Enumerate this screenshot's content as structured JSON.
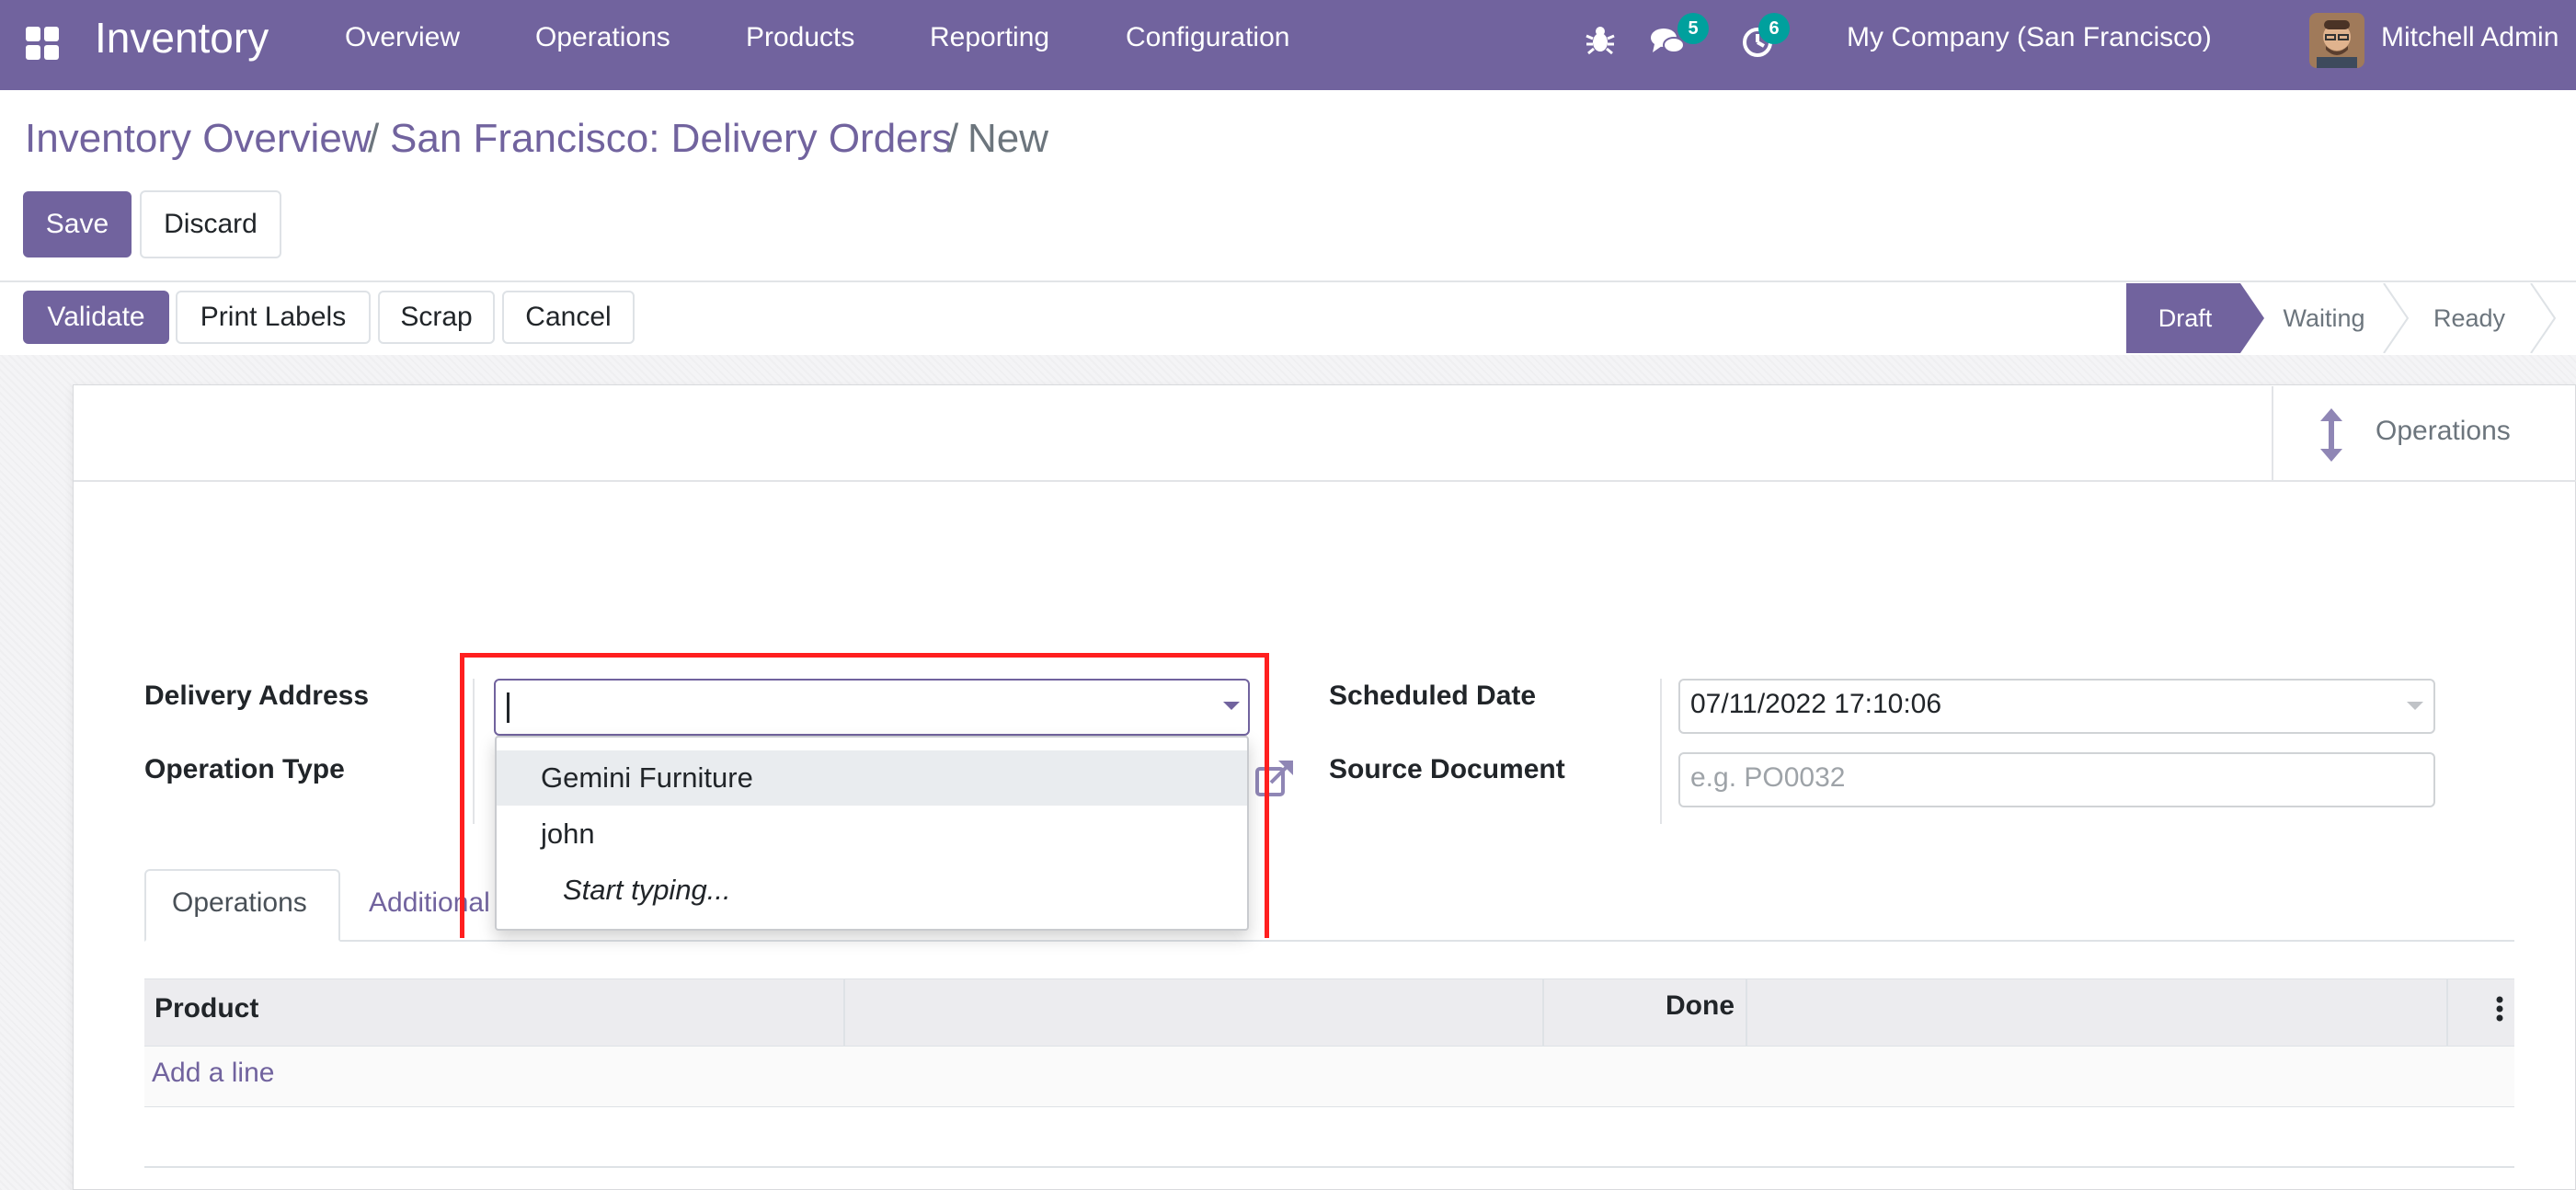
{
  "app": {
    "brand": "Inventory",
    "menus": [
      "Overview",
      "Operations",
      "Products",
      "Reporting",
      "Configuration"
    ],
    "messages_count": "5",
    "activities_count": "6",
    "company": "My Company (San Francisco)",
    "user": "Mitchell Admin",
    "navbar_color": "#71639e"
  },
  "breadcrumb": {
    "items": [
      "Inventory Overview",
      "San Francisco: Delivery Orders"
    ],
    "separator": "/",
    "current": "New"
  },
  "actions": {
    "save": "Save",
    "discard": "Discard"
  },
  "header_buttons": {
    "validate": "Validate",
    "print_labels": "Print Labels",
    "scrap": "Scrap",
    "cancel": "Cancel"
  },
  "status": {
    "steps": [
      "Draft",
      "Waiting",
      "Ready"
    ],
    "active": "Draft"
  },
  "smart_button": {
    "label": "Operations",
    "icon": "arrows-vertical-icon"
  },
  "form": {
    "delivery_address_label": "Delivery Address",
    "delivery_address_value": "",
    "operation_type_label": "Operation Type",
    "scheduled_date_label": "Scheduled Date",
    "scheduled_date_value": "07/11/2022 17:10:06",
    "source_document_label": "Source Document",
    "source_document_placeholder": "e.g. PO0032"
  },
  "autocomplete": {
    "options": [
      "Gemini Furniture",
      "john"
    ],
    "hint": "Start typing...",
    "highlighted": "Gemini Furniture"
  },
  "tabs": {
    "items": [
      "Operations",
      "Additional"
    ],
    "active": "Operations"
  },
  "table": {
    "columns": [
      "Product",
      "",
      "Done"
    ],
    "add_line": "Add a line"
  }
}
